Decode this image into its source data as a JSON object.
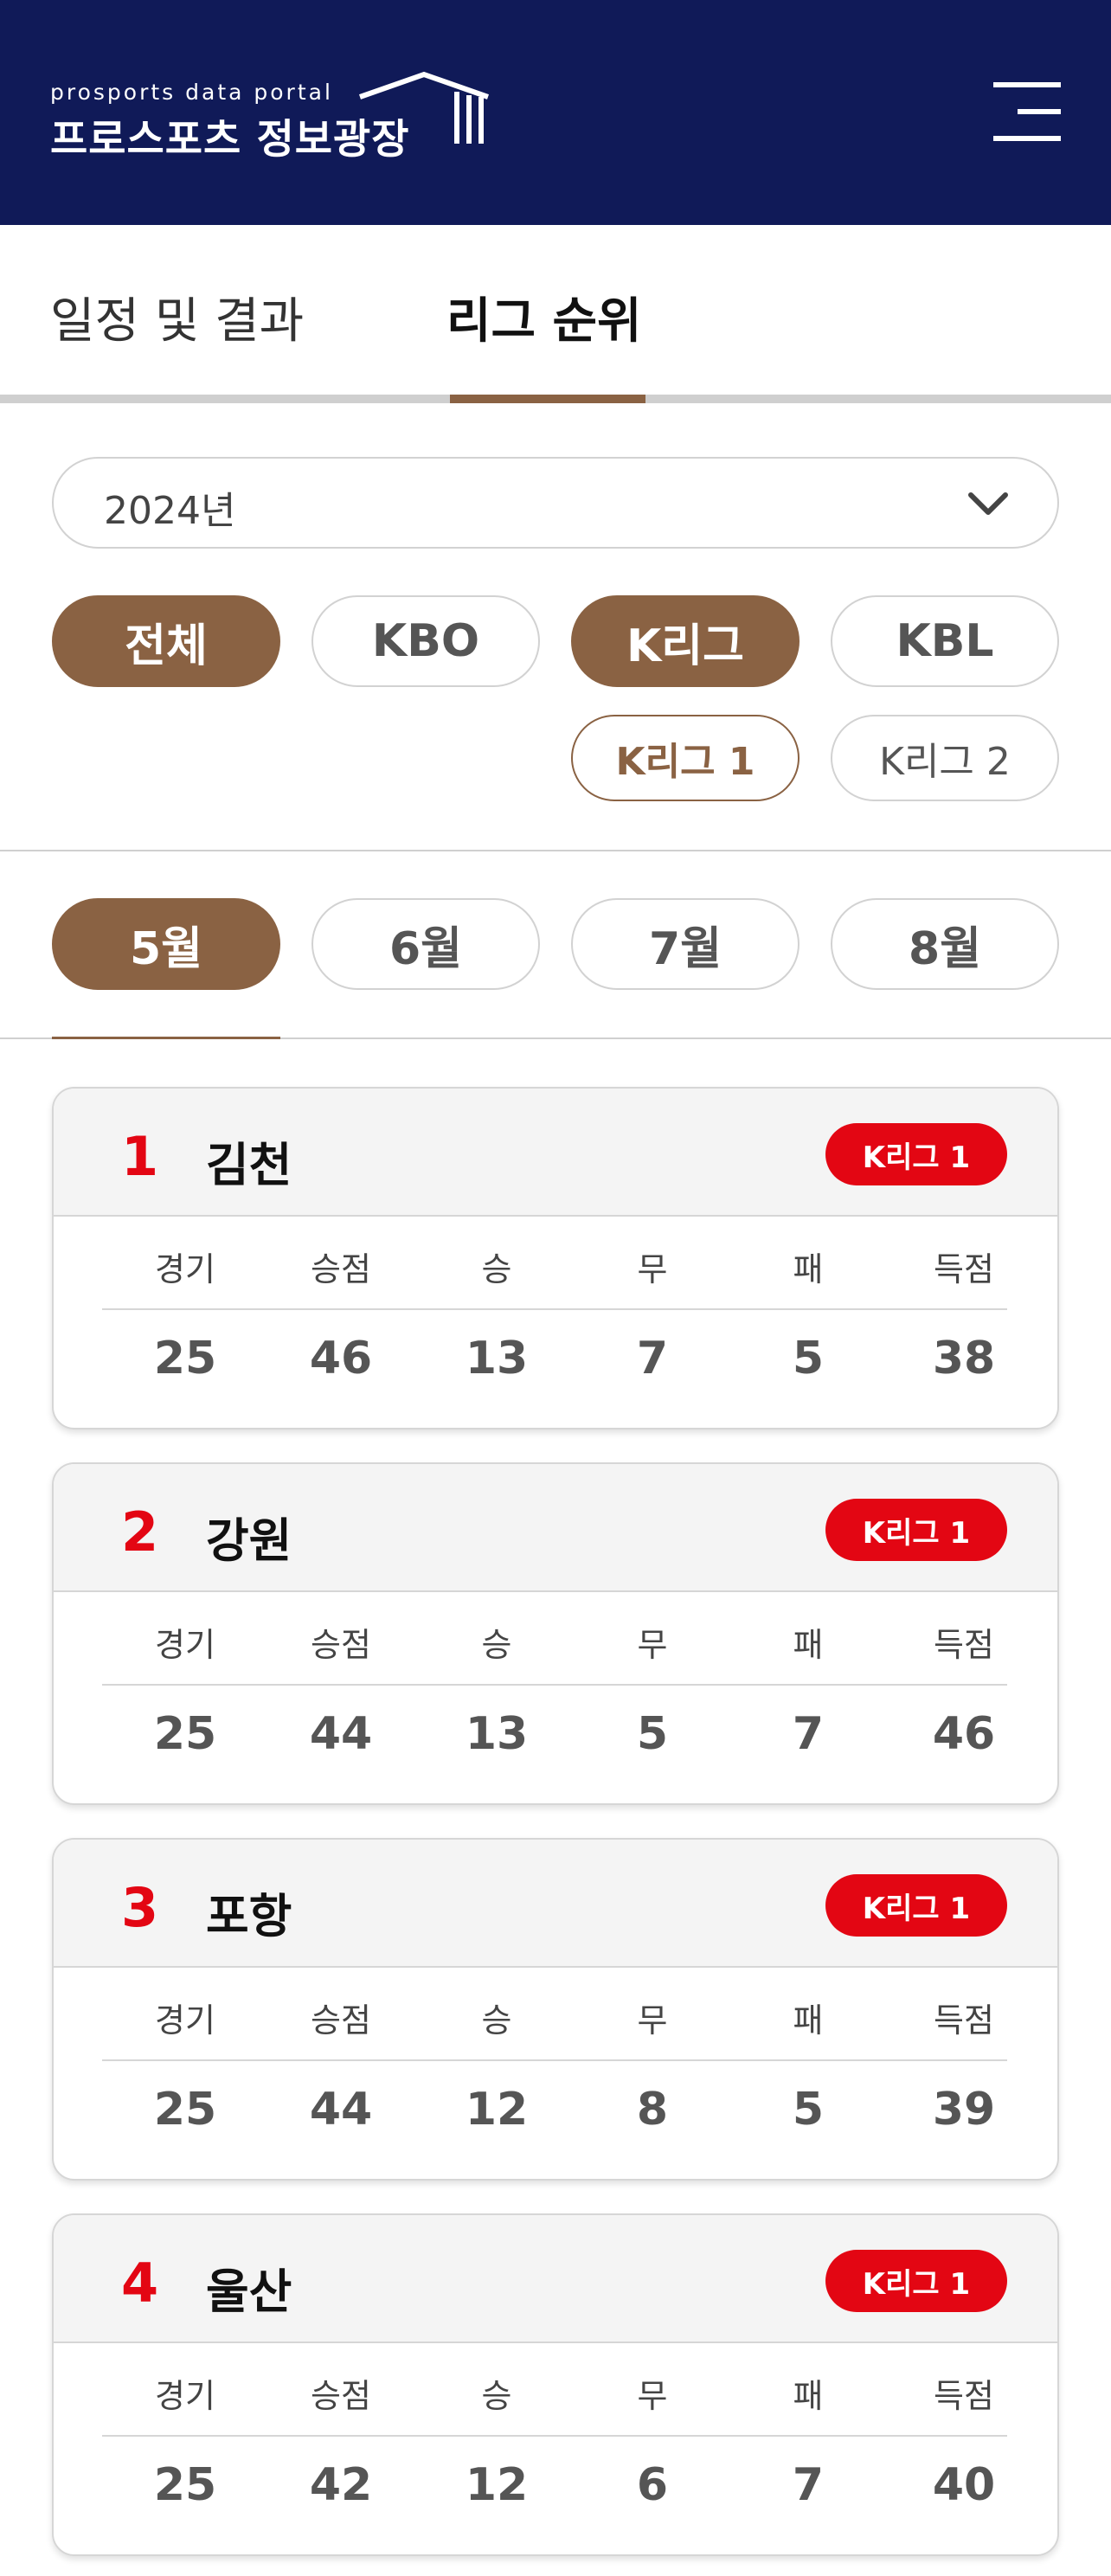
{
  "header": {
    "logo_small": "prosports data portal",
    "logo_big": "프로스포츠 정보광장",
    "menu_icon": "hamburger-menu-icon"
  },
  "tabs": [
    {
      "label": "일정 및 결과",
      "active": false
    },
    {
      "label": "리그 순위",
      "active": true
    }
  ],
  "year_select": {
    "value": "2024년",
    "icon": "chevron-down-icon"
  },
  "league_filters": [
    "전체",
    "KBO",
    "K리그",
    "KBL"
  ],
  "league_sub_filters": [
    "K리그 1",
    "K리그 2"
  ],
  "months": [
    "5월",
    "6월",
    "7월",
    "8월"
  ],
  "stat_labels": [
    "경기",
    "승점",
    "승",
    "무",
    "패",
    "득점"
  ],
  "standings": [
    {
      "rank": "1",
      "team": "김천",
      "league": "K리그 1",
      "stats": [
        "25",
        "46",
        "13",
        "7",
        "5",
        "38"
      ]
    },
    {
      "rank": "2",
      "team": "강원",
      "league": "K리그 1",
      "stats": [
        "25",
        "44",
        "13",
        "5",
        "7",
        "46"
      ]
    },
    {
      "rank": "3",
      "team": "포항",
      "league": "K리그 1",
      "stats": [
        "25",
        "44",
        "12",
        "8",
        "5",
        "39"
      ]
    },
    {
      "rank": "4",
      "team": "울산",
      "league": "K리그 1",
      "stats": [
        "25",
        "42",
        "12",
        "6",
        "7",
        "40"
      ]
    }
  ],
  "colors": {
    "header_bg": "#101a58",
    "accent_brown": "#8a6243",
    "rank_red": "#e30613",
    "badge_red": "#e30613"
  }
}
